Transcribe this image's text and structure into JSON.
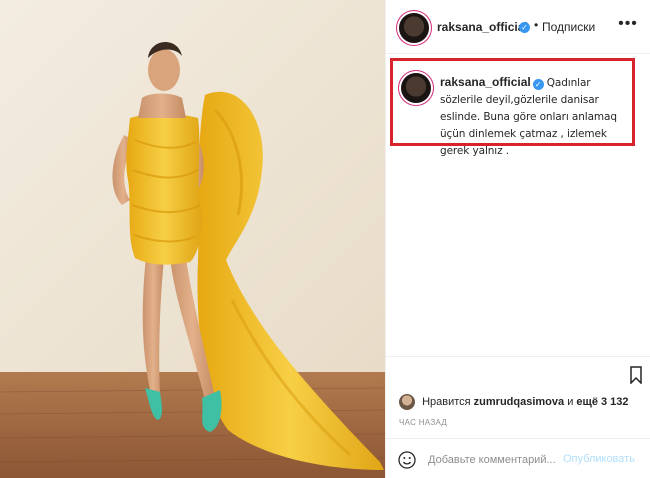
{
  "post": {
    "author": {
      "username": "raksana_official",
      "verified": true,
      "verified_icon": "verified-badge-icon"
    },
    "header": {
      "separator": "•",
      "follow_label": "Подписки",
      "more_icon": "more-options-icon"
    },
    "caption": {
      "username": "raksana_official",
      "text": "Qadınlar sözlerile deyil,gözlerile danisar eslinde. Buna göre onları anlamaq üçün dinlemek çatmaz , izlemek gerek yalnız ."
    },
    "likes": {
      "prefix": "Нравится",
      "liker": "zumrudqasimova",
      "connector": "и",
      "others_label": "ещё 3 132"
    },
    "timestamp": "ЧАС НАЗАД",
    "comment": {
      "placeholder": "Добавьте комментарий...",
      "post_label": "Опубликовать"
    }
  },
  "colors": {
    "highlight_border": "#d8232a",
    "verified_blue": "#3897f0",
    "post_disabled": "#b2dffc",
    "dress_yellow": "#f2c12e",
    "wall": "#efe6d6",
    "floor": "#a66e45",
    "shoes": "#3fbfa3"
  }
}
